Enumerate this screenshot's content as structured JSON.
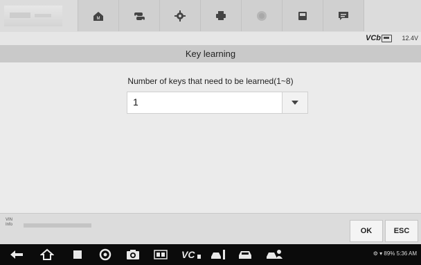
{
  "toolbar": {
    "buttons": [
      {
        "name": "home-icon",
        "label": "M"
      },
      {
        "name": "vehicle-swap-icon"
      },
      {
        "name": "settings-icon"
      },
      {
        "name": "print-icon"
      },
      {
        "name": "help-icon"
      },
      {
        "name": "save-icon"
      },
      {
        "name": "message-icon"
      }
    ]
  },
  "status": {
    "vci_label": "VCb",
    "voltage": "12.4V"
  },
  "title": "Key learning",
  "main": {
    "prompt": "Number of keys that need to be learned(1~8)",
    "dropdown_value": "1"
  },
  "footer": {
    "vin_label": "VIN",
    "info_label": "Info",
    "ok_label": "OK",
    "esc_label": "ESC"
  },
  "navbar": {
    "status_text": "89% 5:36 AM"
  }
}
